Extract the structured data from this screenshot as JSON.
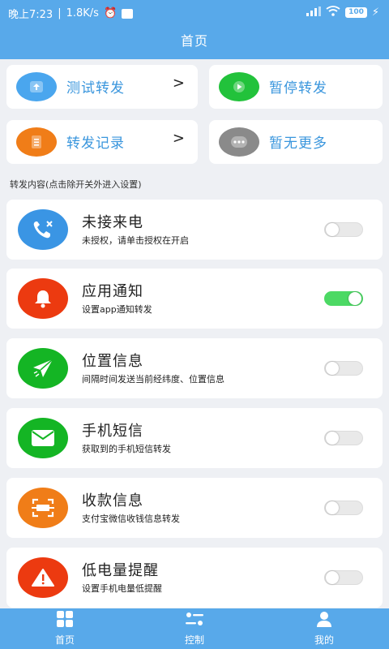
{
  "status_bar": {
    "time": "晚上7:23",
    "speed": "1.8K/s",
    "battery": "100"
  },
  "header": {
    "title": "首页"
  },
  "quick_actions": [
    {
      "label": "测试转发",
      "icon": "upload-icon",
      "color": "#4aa6ee",
      "has_chevron": true
    },
    {
      "label": "暂停转发",
      "icon": "play-icon",
      "color": "#22c23b",
      "has_chevron": false
    },
    {
      "label": "转发记录",
      "icon": "document-icon",
      "color": "#f07d18",
      "has_chevron": true
    },
    {
      "label": "暂无更多",
      "icon": "more-icon",
      "color": "#8a8a8a",
      "has_chevron": false
    }
  ],
  "chevron": ">",
  "section_label": "转发内容(点击除开关外进入设置)",
  "features": [
    {
      "name": "未接来电",
      "desc": "未授权，请单击授权在开启",
      "icon": "missed-call-icon",
      "color": "#3a95e4",
      "enabled": false
    },
    {
      "name": "应用通知",
      "desc": "设置app通知转发",
      "icon": "bell-icon",
      "color": "#ec3a10",
      "enabled": true
    },
    {
      "name": "位置信息",
      "desc": "间隔时间发送当前经纬度、位置信息",
      "icon": "location-arrow-icon",
      "color": "#14b524",
      "enabled": false
    },
    {
      "name": "手机短信",
      "desc": "获取到的手机短信转发",
      "icon": "message-icon",
      "color": "#14b524",
      "enabled": false
    },
    {
      "name": "收款信息",
      "desc": "支付宝微信收钱信息转发",
      "icon": "scan-pay-icon",
      "color": "#f07d18",
      "enabled": false
    },
    {
      "name": "低电量提醒",
      "desc": "设置手机电量低提醒",
      "icon": "warning-icon",
      "color": "#ec3a10",
      "enabled": false
    }
  ],
  "tabs": [
    {
      "label": "首页",
      "icon": "grid-icon"
    },
    {
      "label": "控制",
      "icon": "sliders-icon"
    },
    {
      "label": "我的",
      "icon": "user-icon"
    }
  ]
}
